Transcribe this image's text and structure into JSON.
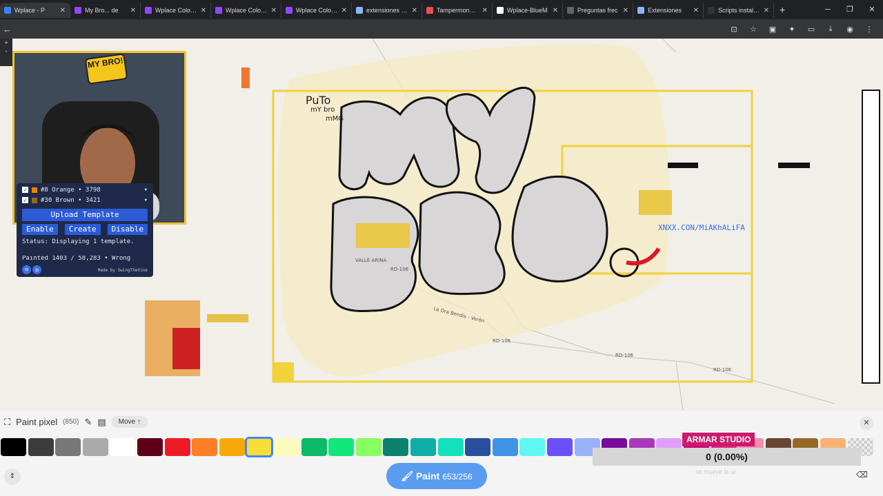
{
  "tabs": [
    {
      "label": "Wplace - P",
      "active": true,
      "icon": "wplace-icon",
      "color": "#3b82f6"
    },
    {
      "label": "My Bro... de",
      "active": false,
      "icon": "twitch-icon",
      "color": "#9146ff"
    },
    {
      "label": "Wplace Color C",
      "active": false,
      "icon": "twitch-icon",
      "color": "#9146ff"
    },
    {
      "label": "Wplace Color C",
      "active": false,
      "icon": "twitch-icon",
      "color": "#9146ff"
    },
    {
      "label": "Wplace Color C",
      "active": false,
      "icon": "twitch-icon",
      "color": "#9146ff"
    },
    {
      "label": "extensiones - B",
      "active": false,
      "icon": "search-icon",
      "color": "#8ab4f8"
    },
    {
      "label": "Tampermonkey",
      "active": false,
      "icon": "tampermonkey-icon",
      "color": "#e84f4f"
    },
    {
      "label": "Wplace-BlueM",
      "active": false,
      "icon": "github-icon",
      "color": "#ffffff"
    },
    {
      "label": "Preguntas frec",
      "active": false,
      "icon": "doc-icon",
      "color": "#5f6368"
    },
    {
      "label": "Extensiones",
      "active": false,
      "icon": "puzzle-icon",
      "color": "#8ab4f8"
    },
    {
      "label": "Scripts instalad",
      "active": false,
      "icon": "tampermonkey-icon",
      "color": "#333333"
    }
  ],
  "webcam": {
    "logo_text": "MY BRO!"
  },
  "template_panel": {
    "color_rows": [
      {
        "label": "#8 Orange • 3798",
        "color": "#f77f00"
      },
      {
        "label": "#30 Brown • 3421",
        "color": "#95682a"
      }
    ],
    "upload_label": "Upload Template",
    "enable_label": "Enable",
    "create_label": "Create",
    "disable_label": "Disable",
    "status_text": "Status: Displaying 1 template.",
    "painted_text": "Painted 1403 / 58,283 • Wrong",
    "made_by": "Made by SwingTheVine"
  },
  "map_labels": {
    "title_text": "PuTo",
    "subtitle_text": "mY bro",
    "subtitle2_text": "mMG",
    "watermark_text": "XNXX.CON/MiAKhALiFA",
    "town_label": "VALLE ARINA",
    "road1": "RD-106",
    "road2": "RD-106",
    "road3": "RD-106",
    "road4": "RD-106",
    "road5": "La Ora Bendis - Verón"
  },
  "bottom": {
    "paint_pixel_label": "Paint pixel",
    "paint_pixel_count": "(850)",
    "move_label": "Move ↑",
    "overlay_title": "ARMAR STUDIO",
    "percent_text": "0 (0.00%)",
    "ghost_text": "se mueve la ui",
    "paint_button_label": "Paint",
    "paint_button_count": "653/256",
    "palette": [
      "#000000",
      "#3c3c3c",
      "#787878",
      "#aaaaaa",
      "#ffffff",
      "#600018",
      "#ed1c24",
      "#ff7f27",
      "#f6aa09",
      "#f9dd3b",
      "#fffabc",
      "#0eb968",
      "#13e67b",
      "#87ff5e",
      "#0c816e",
      "#10aea6",
      "#13e1be",
      "#28509e",
      "#4093e4",
      "#60f7f2",
      "#6b50f6",
      "#99b1fb",
      "#780c99",
      "#aa38b9",
      "#e09ff9",
      "#cb007a",
      "#ec1f80",
      "#f38da9",
      "#684634",
      "#95682a",
      "#f8b277",
      "#d6d6d6"
    ],
    "selected_color_index": 9
  }
}
